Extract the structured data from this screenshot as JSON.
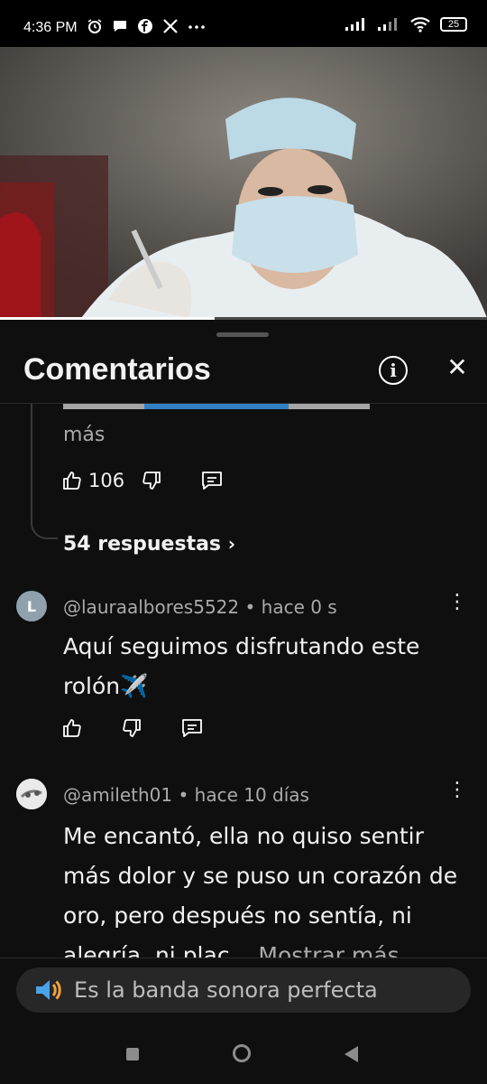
{
  "status_bar": {
    "time": "4:36 PM",
    "battery": "25",
    "icons_left": [
      "alarm-icon",
      "chat-bubble-icon",
      "facebook-icon",
      "x-icon",
      "more-dots-icon"
    ],
    "icons_right": [
      "signal-icon",
      "signal-icon",
      "wifi-icon",
      "battery-icon"
    ]
  },
  "video": {
    "progress_fraction": 0.44
  },
  "sheet": {
    "title": "Comentarios",
    "info_icon": "i",
    "close_icon": "✕"
  },
  "previous_comment": {
    "more_text": "más",
    "likes": "106",
    "replies_link": "54 respuestas"
  },
  "comments": [
    {
      "avatar_letter": "L",
      "avatar_color": "#8fa1ad",
      "author": "@lauraalbores5522",
      "time": "• hace 0 s",
      "text": "Aquí seguimos disfrutando este rolón✈️"
    },
    {
      "author": "@amileth01",
      "time": "• hace 10 días",
      "text": "Me encantó, ella no quiso sentir más dolor y se puso un corazón de oro, pero después no sentía, ni alegría, ni plac...",
      "show_more": "Mostrar más"
    }
  ],
  "reply_bar": {
    "placeholder": "Es la banda sonora perfecta",
    "icon": "speaker-icon"
  },
  "colors": {
    "background": "#0f0f0f",
    "accent_link": "#3ea6ff",
    "secondary_text": "#aaaaaa"
  }
}
